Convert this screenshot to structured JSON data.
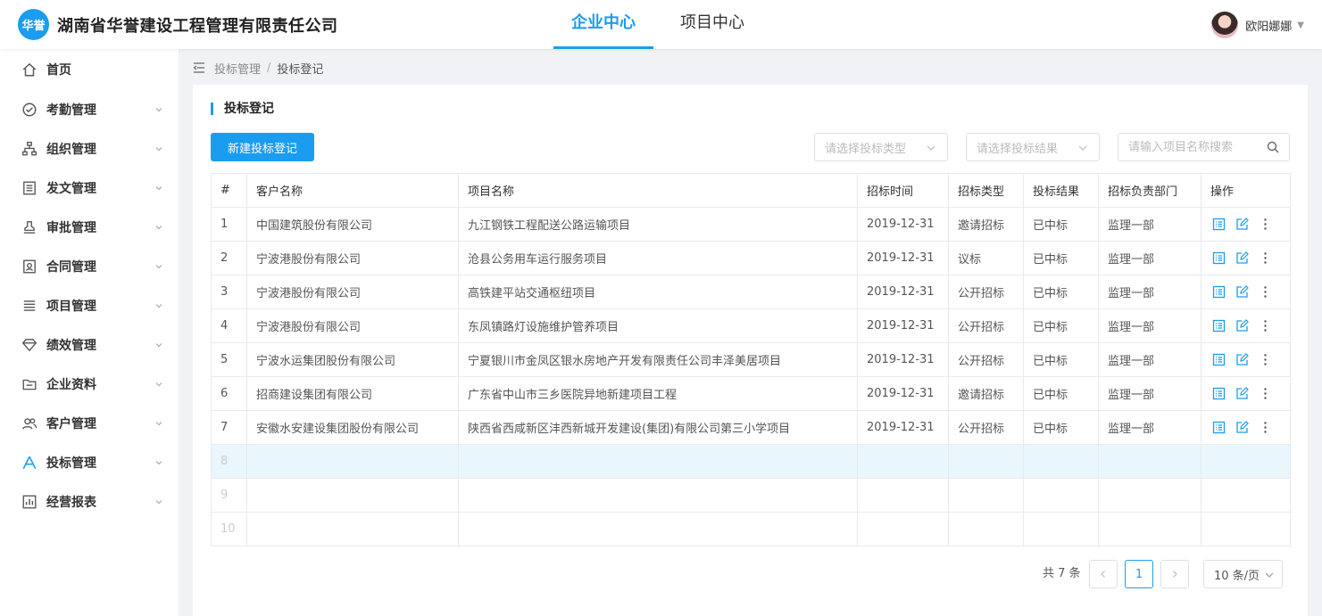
{
  "header": {
    "logo_text": "华誉",
    "company": "湖南省华誉建设工程管理有限责任公司",
    "tabs": [
      {
        "label": "企业中心",
        "active": true
      },
      {
        "label": "项目中心",
        "active": false
      }
    ],
    "user_name": "欧阳娜娜",
    "accent_color": "#1a9df0"
  },
  "sidebar": {
    "items": [
      {
        "label": "首页",
        "icon": "home-icon",
        "has_chevron": false
      },
      {
        "label": "考勤管理",
        "icon": "check-circle-icon",
        "has_chevron": true
      },
      {
        "label": "组织管理",
        "icon": "org-chart-icon",
        "has_chevron": true
      },
      {
        "label": "发文管理",
        "icon": "document-icon",
        "has_chevron": true
      },
      {
        "label": "审批管理",
        "icon": "stamp-icon",
        "has_chevron": true
      },
      {
        "label": "合同管理",
        "icon": "contract-icon",
        "has_chevron": true
      },
      {
        "label": "项目管理",
        "icon": "list-icon",
        "has_chevron": true
      },
      {
        "label": "绩效管理",
        "icon": "diamond-icon",
        "has_chevron": true
      },
      {
        "label": "企业资料",
        "icon": "folder-icon",
        "has_chevron": true
      },
      {
        "label": "客户管理",
        "icon": "users-icon",
        "has_chevron": true
      },
      {
        "label": "投标管理",
        "icon": "bid-icon",
        "has_chevron": true,
        "active": true
      },
      {
        "label": "经营报表",
        "icon": "bar-chart-icon",
        "has_chevron": true
      }
    ]
  },
  "breadcrumb": {
    "parent": "投标管理",
    "current": "投标登记"
  },
  "main": {
    "title": "投标登记",
    "new_button": "新建投标登记",
    "filter_type_placeholder": "请选择投标类型",
    "filter_result_placeholder": "请选择投标结果",
    "search_placeholder": "请输入项目名称搜索"
  },
  "table": {
    "columns": [
      "#",
      "客户名称",
      "项目名称",
      "招标时间",
      "招标类型",
      "投标结果",
      "招标负责部门",
      "操作"
    ],
    "rows": [
      [
        "1",
        "中国建筑股份有限公司",
        "九江钢铁工程配送公路运输项目",
        "2019-12-31",
        "邀请招标",
        "已中标",
        "监理一部"
      ],
      [
        "2",
        "宁波港股份有限公司",
        "沧县公务用车运行服务项目",
        "2019-12-31",
        "议标",
        "已中标",
        "监理一部"
      ],
      [
        "3",
        "宁波港股份有限公司",
        "高铁建平站交通枢纽项目",
        "2019-12-31",
        "公开招标",
        "已中标",
        "监理一部"
      ],
      [
        "4",
        "宁波港股份有限公司",
        "东凤镇路灯设施维护管养项目",
        "2019-12-31",
        "公开招标",
        "已中标",
        "监理一部"
      ],
      [
        "5",
        "宁波水运集团股份有限公司",
        "宁夏银川市金凤区银水房地产开发有限责任公司丰泽美居项目",
        "2019-12-31",
        "公开招标",
        "已中标",
        "监理一部"
      ],
      [
        "6",
        "招商建设集团有限公司",
        "广东省中山市三乡医院异地新建项目工程",
        "2019-12-31",
        "邀请招标",
        "已中标",
        "监理一部"
      ],
      [
        "7",
        "安徽水安建设集团股份有限公司",
        "陕西省西咸新区沣西新城开发建设(集团)有限公司第三小学项目",
        "2019-12-31",
        "公开招标",
        "已中标",
        "监理一部"
      ]
    ],
    "empty_rows": [
      "8",
      "9",
      "10"
    ]
  },
  "pagination": {
    "total_text": "共 7 条",
    "current_page": "1",
    "page_size": "10 条/页"
  }
}
